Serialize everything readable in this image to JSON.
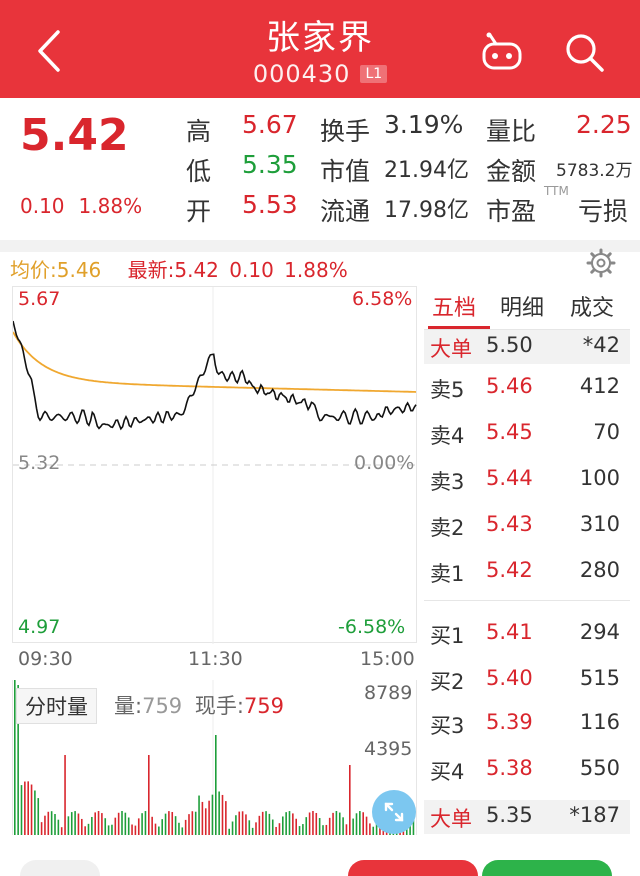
{
  "header": {
    "title": "张家界",
    "code": "000430",
    "badge": "L1"
  },
  "quote": {
    "price": "5.42",
    "change": "0.10",
    "change_pct": "1.88%",
    "high_label": "高",
    "high": "5.67",
    "low_label": "低",
    "low": "5.35",
    "open_label": "开",
    "open": "5.53",
    "turnover_label": "换手",
    "turnover": "3.19%",
    "mcap_label": "市值",
    "mcap": "21.94亿",
    "float_label": "流通",
    "float": "17.98亿",
    "volratio_label": "量比",
    "volratio": "2.25",
    "amount_label": "金额",
    "amount": "5783.2万",
    "pe_label": "市盈",
    "pe_sup": "TTM",
    "pe": "亏损"
  },
  "intraday": {
    "avg_label": "均价:5.46",
    "latest_label": "最新:5.42",
    "latest_change": "0.10",
    "latest_pct": "1.88%",
    "y_top": "5.67",
    "y_mid": "5.32",
    "y_bot": "4.97",
    "pct_top": "6.58%",
    "pct_mid": "0.00%",
    "pct_bot": "-6.58%",
    "t_start": "09:30",
    "t_mid": "11:30",
    "t_end": "15:00"
  },
  "volume": {
    "tab": "分时量",
    "vol_label": "量:",
    "vol_value": "759",
    "hand_label": "现手:",
    "hand_value": "759",
    "max": "8789",
    "mid": "4395"
  },
  "orderbook": {
    "tabs": [
      "五档",
      "明细",
      "成交"
    ],
    "big_sell": {
      "label": "大单",
      "price": "5.50",
      "vol": "*42"
    },
    "sells": [
      {
        "name": "卖5",
        "price": "5.46",
        "vol": "412"
      },
      {
        "name": "卖4",
        "price": "5.45",
        "vol": "70"
      },
      {
        "name": "卖3",
        "price": "5.44",
        "vol": "100"
      },
      {
        "name": "卖2",
        "price": "5.43",
        "vol": "310"
      },
      {
        "name": "卖1",
        "price": "5.42",
        "vol": "280"
      }
    ],
    "buys": [
      {
        "name": "买1",
        "price": "5.41",
        "vol": "294"
      },
      {
        "name": "买2",
        "price": "5.40",
        "vol": "515"
      },
      {
        "name": "买3",
        "price": "5.39",
        "vol": "116"
      },
      {
        "name": "买4",
        "price": "5.38",
        "vol": "550"
      }
    ],
    "big_buy": {
      "label": "大单",
      "price": "5.35",
      "vol": "*187"
    }
  },
  "colors": {
    "header": "#e8343b",
    "up": "#d9262d",
    "down": "#1e9e3a",
    "avg": "#f0a830"
  }
}
